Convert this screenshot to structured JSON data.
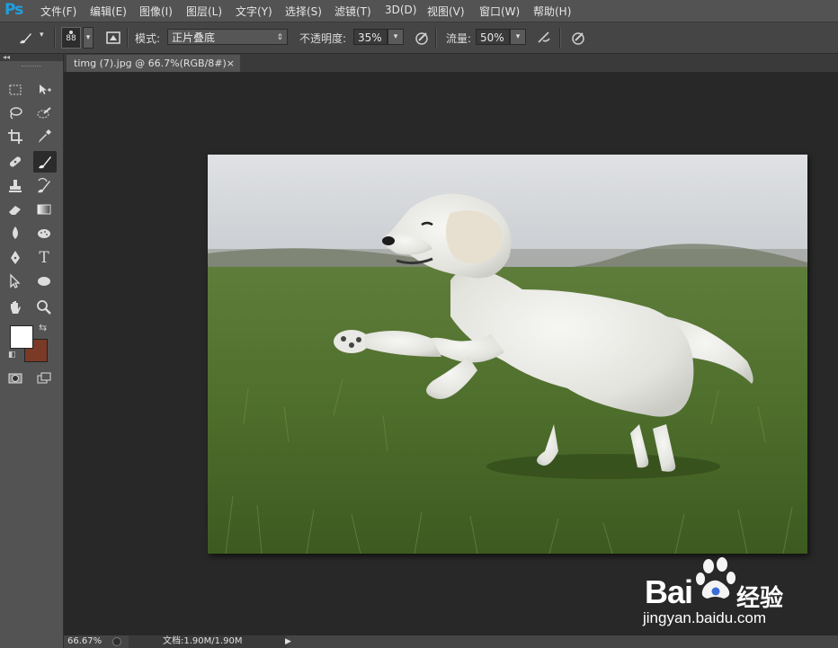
{
  "app": {
    "logo": "Ps"
  },
  "menu": [
    "文件(F)",
    "编辑(E)",
    "图像(I)",
    "图层(L)",
    "文字(Y)",
    "选择(S)",
    "滤镜(T)",
    "3D(D)",
    "视图(V)",
    "窗口(W)",
    "帮助(H)"
  ],
  "options": {
    "brush_size": "88",
    "mode_label": "模式:",
    "mode_value": "正片叠底",
    "opacity_label": "不透明度:",
    "opacity_value": "35%",
    "flow_label": "流量:",
    "flow_value": "50%"
  },
  "document": {
    "tab_title": "timg (7).jpg @ 66.7%(RGB/8#)",
    "tab_close": "×"
  },
  "status": {
    "zoom": "66.67%",
    "doc_info": "文档:1.90M/1.90M"
  },
  "colors": {
    "foreground": "#ffffff",
    "background": "#7a3a26"
  },
  "icons": {
    "brush": "brush-icon",
    "marquee": "rect-marquee-icon",
    "move": "move-icon",
    "lasso": "lasso-icon",
    "quick_select": "quick-select-icon",
    "crop": "crop-icon",
    "eyedropper": "eyedropper-icon",
    "healing": "healing-brush-icon",
    "stamp": "clone-stamp-icon",
    "history_brush": "history-brush-icon",
    "eraser": "eraser-icon",
    "gradient": "gradient-icon",
    "blur": "blur-icon",
    "dodge": "dodge-icon",
    "pen": "pen-icon",
    "type": "type-icon",
    "path_select": "path-select-icon",
    "ellipse": "ellipse-icon",
    "hand": "hand-icon",
    "zoom": "zoom-icon"
  },
  "watermark": {
    "brand": "Bai",
    "brand_cn": "经验",
    "url": "jingyan.baidu.com"
  }
}
